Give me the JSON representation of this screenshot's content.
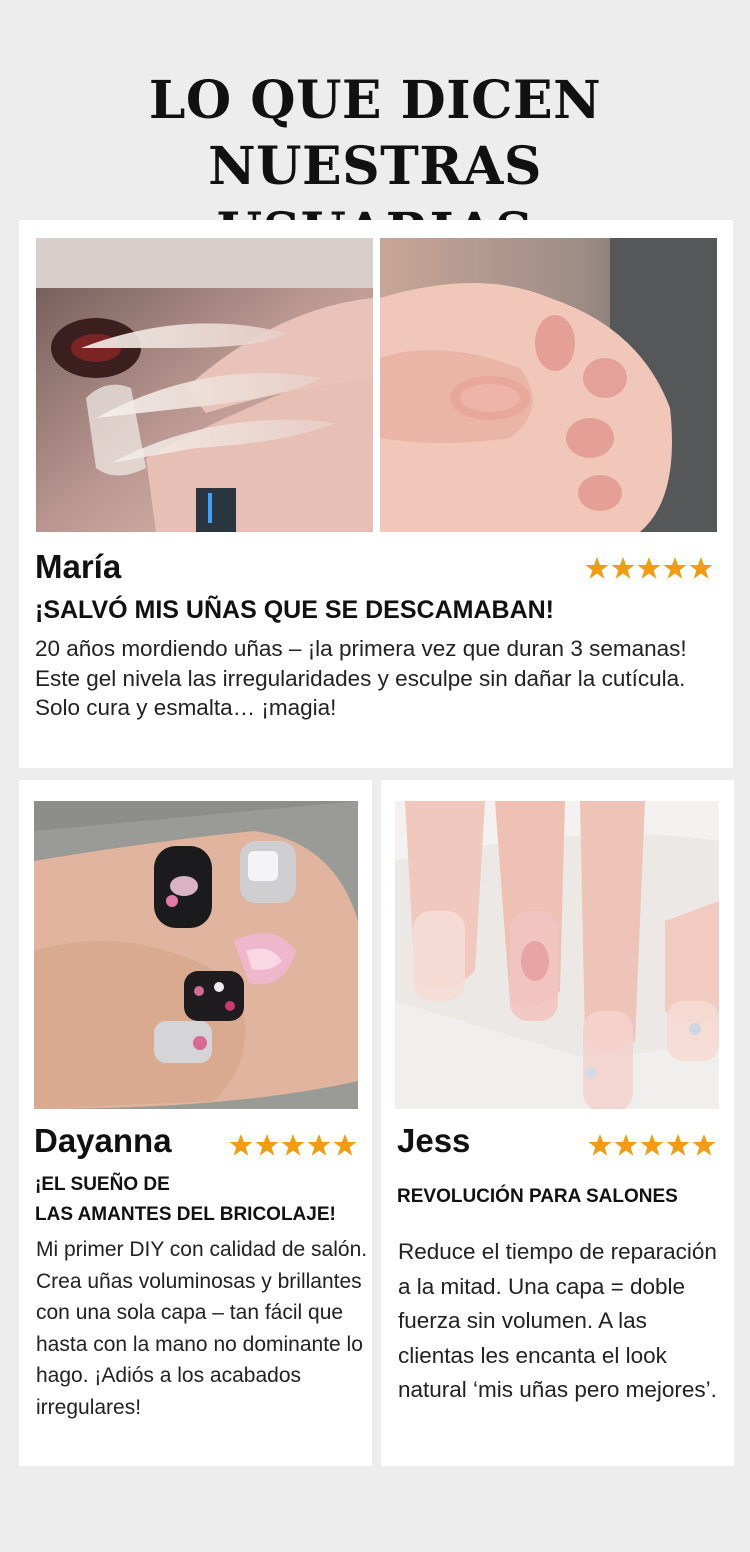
{
  "page": {
    "title_line1": "LO QUE DICEN NUESTRAS",
    "title_line2": "USUARIAS"
  },
  "colors": {
    "background": "#ededed",
    "card": "#ffffff",
    "star": "#f39c12",
    "text": "#111111"
  },
  "reviews": [
    {
      "name": "María",
      "rating": 5,
      "headline": "¡SALVÓ MIS UÑAS QUE SE DESCAMABAN!",
      "body": "20 años mordiendo uñas – ¡la primera vez que duran 3 semanas! Este gel nivela las irregularidades y esculpe sin dañar la cutícula. Solo cura y esmalta… ¡magia!",
      "photos": [
        "long-clear-stiletto-nails-photo",
        "short-pink-natural-nails-photo"
      ]
    },
    {
      "name": "Dayanna",
      "rating": 5,
      "headline_line1": "¡EL SUEÑO DE",
      "headline_line2": "LAS AMANTES DEL BRICOLAJE!",
      "body": "Mi primer DIY con calidad de salón. Crea uñas voluminosas y brillantes con una sola capa – tan fácil que hasta con la mano no dominante lo hago. ¡Adiós a los acabados irregulares!",
      "photos": [
        "decorated-black-jeweled-nails-photo"
      ]
    },
    {
      "name": "Jess",
      "rating": 5,
      "headline": "REVOLUCIÓN PARA SALONES",
      "body": "Reduce el tiempo de reparación a la mitad. Una capa = doble fuerza sin volumen. A las clientas les encanta el look natural ‘mis uñas pero mejores’.",
      "photos": [
        "sheer-pink-square-nails-photo"
      ]
    }
  ]
}
